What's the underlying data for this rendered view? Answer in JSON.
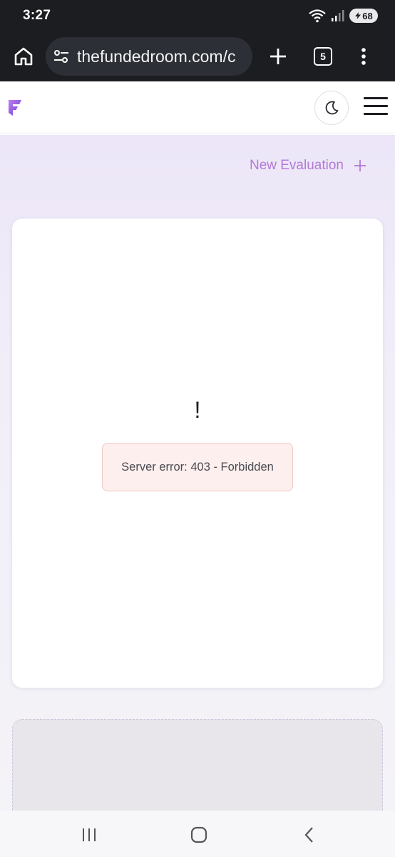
{
  "status_bar": {
    "time": "3:27",
    "battery": "68",
    "wifi_icon": "wifi-icon",
    "signal_icon": "signal-icon"
  },
  "browser": {
    "url": "thefundedroom.com/c",
    "tab_count": "5"
  },
  "header": {
    "logo_letter": "F",
    "brand_color": "#9b5de5"
  },
  "main": {
    "new_evaluation_label": "New Evaluation",
    "new_evaluation_icon": "+",
    "error_symbol": "!",
    "error_message": "Server error: 403 - Forbidden",
    "accent_color": "#b37ad6",
    "error_bg_color": "#fdefee"
  },
  "nav": {
    "recents_icon": "recents-icon",
    "home_icon": "home-icon",
    "back_icon": "back-icon"
  }
}
